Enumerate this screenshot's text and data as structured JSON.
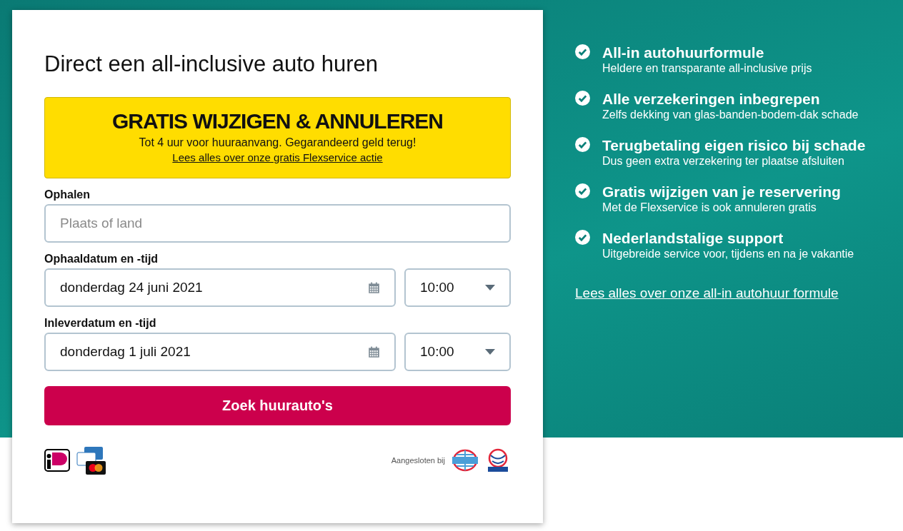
{
  "form": {
    "title": "Direct een all-inclusive auto huren",
    "promo": {
      "heading": "GRATIS WIJZIGEN & ANNULEREN",
      "text": "Tot 4 uur voor huuraanvang. Gegarandeerd geld terug!",
      "link": "Lees alles over onze gratis Flexservice actie"
    },
    "pickup": {
      "label": "Ophalen",
      "placeholder": "Plaats of land"
    },
    "dates": [
      {
        "label": "Ophaaldatum en -tijd",
        "date": "donderdag 24 juni 2021",
        "time": "10:00"
      },
      {
        "label": "Inleverdatum en -tijd",
        "date": "donderdag 1 juli 2021",
        "time": "10:00"
      }
    ],
    "submit": "Zoek huurauto's",
    "affiliated": "Aangesloten bij"
  },
  "benefits": {
    "items": [
      {
        "title": "All-in autohuurformule",
        "text": "Heldere en transparante all-inclusive prijs"
      },
      {
        "title": "Alle verzekeringen inbegrepen",
        "text": "Zelfs dekking van glas-banden-bodem-dak schade"
      },
      {
        "title": "Terugbetaling eigen risico bij schade",
        "text": "Dus geen extra verzekering ter plaatse afsluiten"
      },
      {
        "title": "Gratis wijzigen van je reservering",
        "text": "Met de Flexservice is ook annuleren gratis"
      },
      {
        "title": "Nederlandstalige support",
        "text": "Uitgebreide service voor, tijdens en na je vakantie"
      }
    ],
    "link": "Lees alles over onze all-in autohuur formule"
  }
}
